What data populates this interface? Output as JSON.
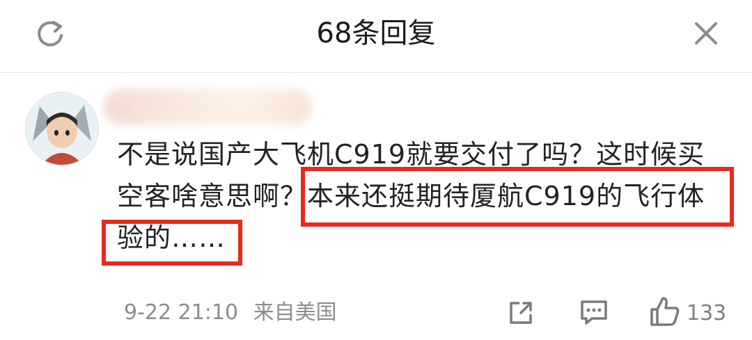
{
  "header": {
    "title": "68条回复",
    "refresh_icon": "refresh-icon",
    "close_icon": "close-icon"
  },
  "comment": {
    "line1": "不是说国产大飞机C919就要交付了吗？这时候买",
    "line2_a": "空客啥意思啊？",
    "line2_b": "本来还挺期待厦航C919的飞行体",
    "line3": "验的……",
    "highlight_color": "#e8291c"
  },
  "footer": {
    "timestamp": "9-22 21:10",
    "source": "来自美国",
    "share_icon": "share-icon",
    "reply_icon": "comment-icon",
    "like_icon": "thumbs-up-icon",
    "like_count": "133"
  }
}
